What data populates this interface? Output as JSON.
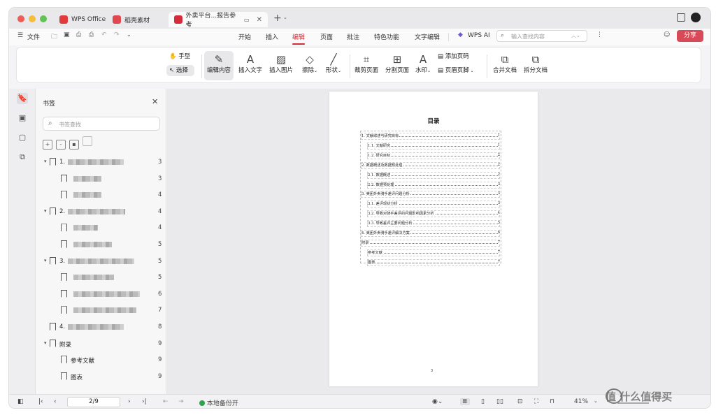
{
  "window": {
    "tabs": [
      {
        "label": "WPS Office",
        "logo_color": "#e03a3a",
        "active": false
      },
      {
        "label": "稻壳素材",
        "logo_color": "#e0474f",
        "active": false
      },
      {
        "label": "外卖平台...报告参考",
        "logo_color": "#d52b3a",
        "active": true
      }
    ]
  },
  "menu": {
    "file_label": "文件",
    "tabs": [
      "开始",
      "插入",
      "编辑",
      "页面",
      "批注",
      "特色功能",
      "文字编辑"
    ],
    "active_tab": "编辑",
    "ai_label": "WPS AI",
    "search_placeholder": "输入查找内容",
    "share_label": "分享"
  },
  "ribbon": {
    "hand_label": "手型",
    "select_label": "选择",
    "edit_content": "编辑内容",
    "insert_text": "插入文字",
    "insert_image": "插入图片",
    "erase": "擦除",
    "shape": "形状",
    "crop_page": "裁剪页面",
    "split_page": "分割页面",
    "watermark": "水印",
    "add_page_num": "添加页码",
    "header_footer": "页眉页脚",
    "merge_doc": "合并文档",
    "split_doc": "拆分文档"
  },
  "sidebar": {
    "title": "书签",
    "search_placeholder": "书签查找",
    "bookmarks": [
      {
        "level": 0,
        "prefix": "1.",
        "label": "",
        "page": "3",
        "blur": 80
      },
      {
        "level": 1,
        "prefix": "",
        "label": "",
        "page": "3",
        "blur": 40
      },
      {
        "level": 1,
        "prefix": "",
        "label": "",
        "page": "4",
        "blur": 40
      },
      {
        "level": 0,
        "prefix": "2.",
        "label": "",
        "page": "4",
        "blur": 82
      },
      {
        "level": 1,
        "prefix": "",
        "label": "",
        "page": "4",
        "blur": 35
      },
      {
        "level": 1,
        "prefix": "",
        "label": "",
        "page": "5",
        "blur": 55
      },
      {
        "level": 0,
        "prefix": "3.",
        "label": "",
        "page": "5",
        "blur": 95
      },
      {
        "level": 1,
        "prefix": "",
        "label": "",
        "page": "5",
        "blur": 58
      },
      {
        "level": 1,
        "prefix": "",
        "label": "",
        "page": "6",
        "blur": 95
      },
      {
        "level": 1,
        "prefix": "",
        "label": "",
        "page": "7",
        "blur": 90
      },
      {
        "level": 0,
        "prefix": "4.",
        "label": "",
        "page": "8",
        "blur": 80
      },
      {
        "level": 0,
        "prefix": "",
        "label": "附录",
        "page": "9",
        "blur": 0
      },
      {
        "level": 1,
        "prefix": "",
        "label": "参考文献",
        "page": "9",
        "blur": 0
      },
      {
        "level": 1,
        "prefix": "",
        "label": "图表",
        "page": "9",
        "blur": 0
      }
    ]
  },
  "document": {
    "toc_title": "目录",
    "page_footer": "3",
    "toc": [
      {
        "indent": 0,
        "text": "1. 文献综述与研究目标",
        "page": "1"
      },
      {
        "indent": 1,
        "text": "1.1. 文献研究",
        "page": "1"
      },
      {
        "indent": 1,
        "text": "1.2. 研究目标",
        "page": "2"
      },
      {
        "indent": 0,
        "text": "2. 数据概述及数据预处理",
        "page": "2"
      },
      {
        "indent": 1,
        "text": "2.1. 数据概述",
        "page": "2"
      },
      {
        "indent": 1,
        "text": "2.2. 数据预处理",
        "page": "3"
      },
      {
        "indent": 0,
        "text": "3. 美团外卖骑手差评问题分析",
        "page": "3"
      },
      {
        "indent": 1,
        "text": "3.1. 差评现状分析",
        "page": "3"
      },
      {
        "indent": 1,
        "text": "3.2. 导致对骑手差评的问题影响因素分析",
        "page": "4"
      },
      {
        "indent": 1,
        "text": "3.3. 导致差评主要问题分析",
        "page": "5"
      },
      {
        "indent": 0,
        "text": "4. 美团外卖骑手差评解决方案",
        "page": "6"
      },
      {
        "indent": 0,
        "text": "附录",
        "page": "7"
      },
      {
        "indent": 1,
        "text": "参考文献",
        "page": "7"
      },
      {
        "indent": 1,
        "text": "图表",
        "page": "7"
      }
    ]
  },
  "status": {
    "page_indicator": "2/9",
    "backup_label": "本地备份开",
    "zoom": "41%"
  },
  "watermark": {
    "text": "值 什么值得买"
  },
  "colors": {
    "accent": "#d52b3a",
    "share_bg": "#d84a57",
    "backup_dot": "#2ba24c"
  }
}
